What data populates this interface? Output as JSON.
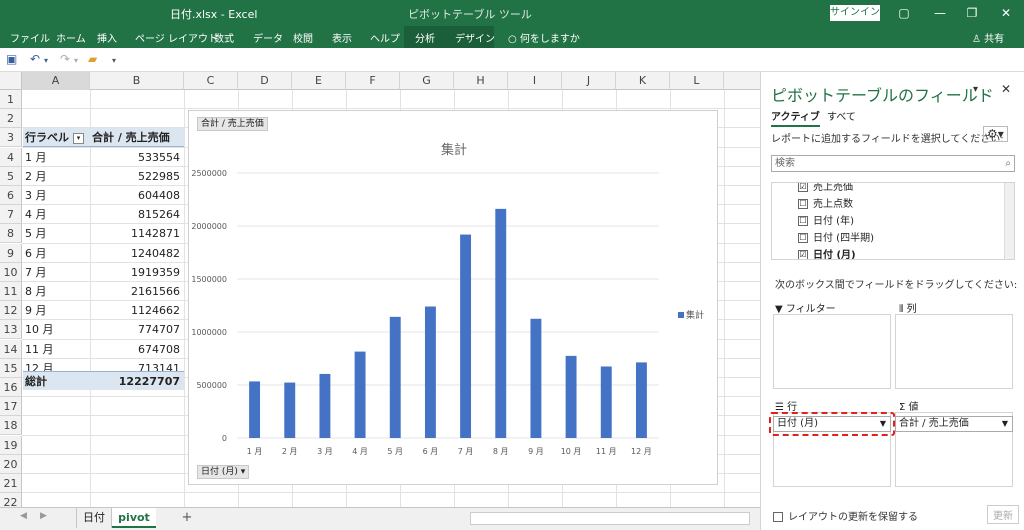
{
  "titlebar": {
    "title": "日付.xlsx  -  Excel",
    "context_label": "ピボットテーブル ツール",
    "signin": "サインイン",
    "restore": "▢",
    "minimize": "—",
    "maximize": "❐",
    "close": "✕"
  },
  "ribbon": {
    "tabs": [
      "ファイル",
      "ホーム",
      "挿入",
      "ページ レイアウト",
      "数式",
      "データ",
      "校閲",
      "表示",
      "ヘルプ",
      "分析",
      "デザイン"
    ],
    "tell_me": "何をしますか",
    "share": "共有"
  },
  "grid": {
    "columns": [
      "A",
      "B",
      "C",
      "D",
      "E",
      "F",
      "G",
      "H",
      "I",
      "J",
      "K",
      "L"
    ],
    "rows": [
      "1",
      "2",
      "3",
      "4",
      "5",
      "6",
      "7",
      "8",
      "9",
      "10",
      "11",
      "12",
      "13",
      "14",
      "15",
      "16",
      "17",
      "18",
      "19",
      "20",
      "21",
      "22"
    ],
    "pivot": {
      "header_label": "行ラベル",
      "header_value": "合計 / 売上売価",
      "rows": [
        {
          "label": "1 月",
          "value": "533554"
        },
        {
          "label": "2 月",
          "value": "522985"
        },
        {
          "label": "3 月",
          "value": "604408"
        },
        {
          "label": "4 月",
          "value": "815264"
        },
        {
          "label": "5 月",
          "value": "1142871"
        },
        {
          "label": "6 月",
          "value": "1240482"
        },
        {
          "label": "7 月",
          "value": "1919359"
        },
        {
          "label": "8 月",
          "value": "2161566"
        },
        {
          "label": "9 月",
          "value": "1124662"
        },
        {
          "label": "10 月",
          "value": "774707"
        },
        {
          "label": "11 月",
          "value": "674708"
        },
        {
          "label": "12 月",
          "value": "713141"
        }
      ],
      "total_label": "総計",
      "total_value": "12227707"
    }
  },
  "chart": {
    "value_chip": "合計 / 売上売価",
    "axis_chip": "日付 (月) ▾",
    "legend_label": "集計"
  },
  "chart_data": {
    "type": "bar",
    "title": "集計",
    "categories": [
      "1 月",
      "2 月",
      "3 月",
      "4 月",
      "5 月",
      "6 月",
      "7 月",
      "8 月",
      "9 月",
      "10 月",
      "11 月",
      "12 月"
    ],
    "series": [
      {
        "name": "集計",
        "values": [
          533554,
          522985,
          604408,
          815264,
          1142871,
          1240482,
          1919359,
          2161566,
          1124662,
          774707,
          674708,
          713141
        ]
      }
    ],
    "yticks": [
      "0",
      "500000",
      "1000000",
      "1500000",
      "2000000",
      "2500000"
    ],
    "ylim": [
      0,
      2500000
    ],
    "legend_position": "right",
    "bar_color": "#4472c4"
  },
  "pane": {
    "title": "ピボットテーブルのフィールド",
    "tab_active": "アクティブ",
    "tab_all": "すべて",
    "choose_label": "レポートに追加するフィールドを選択してください:",
    "search_placeholder": "検索",
    "fields": [
      {
        "label": "売上売価",
        "checked": "☑"
      },
      {
        "label": "売上点数",
        "checked": "☐"
      },
      {
        "label": "日付 (年)",
        "checked": "☐"
      },
      {
        "label": "日付 (四半期)",
        "checked": "☐"
      },
      {
        "label": "日付 (月)",
        "checked": "☑"
      }
    ],
    "drag_label": "次のボックス間でフィールドをドラッグしてください:",
    "area_filter": "フィルター",
    "area_columns": "列",
    "area_rows": "行",
    "area_values": "値",
    "rows_item": "日付 (月)",
    "values_item": "合計 / 売上売価",
    "defer_label": "レイアウトの更新を保留する",
    "update_button": "更新"
  },
  "sheets": {
    "tab1": "日付",
    "tab2": "pivot",
    "add": "+"
  }
}
